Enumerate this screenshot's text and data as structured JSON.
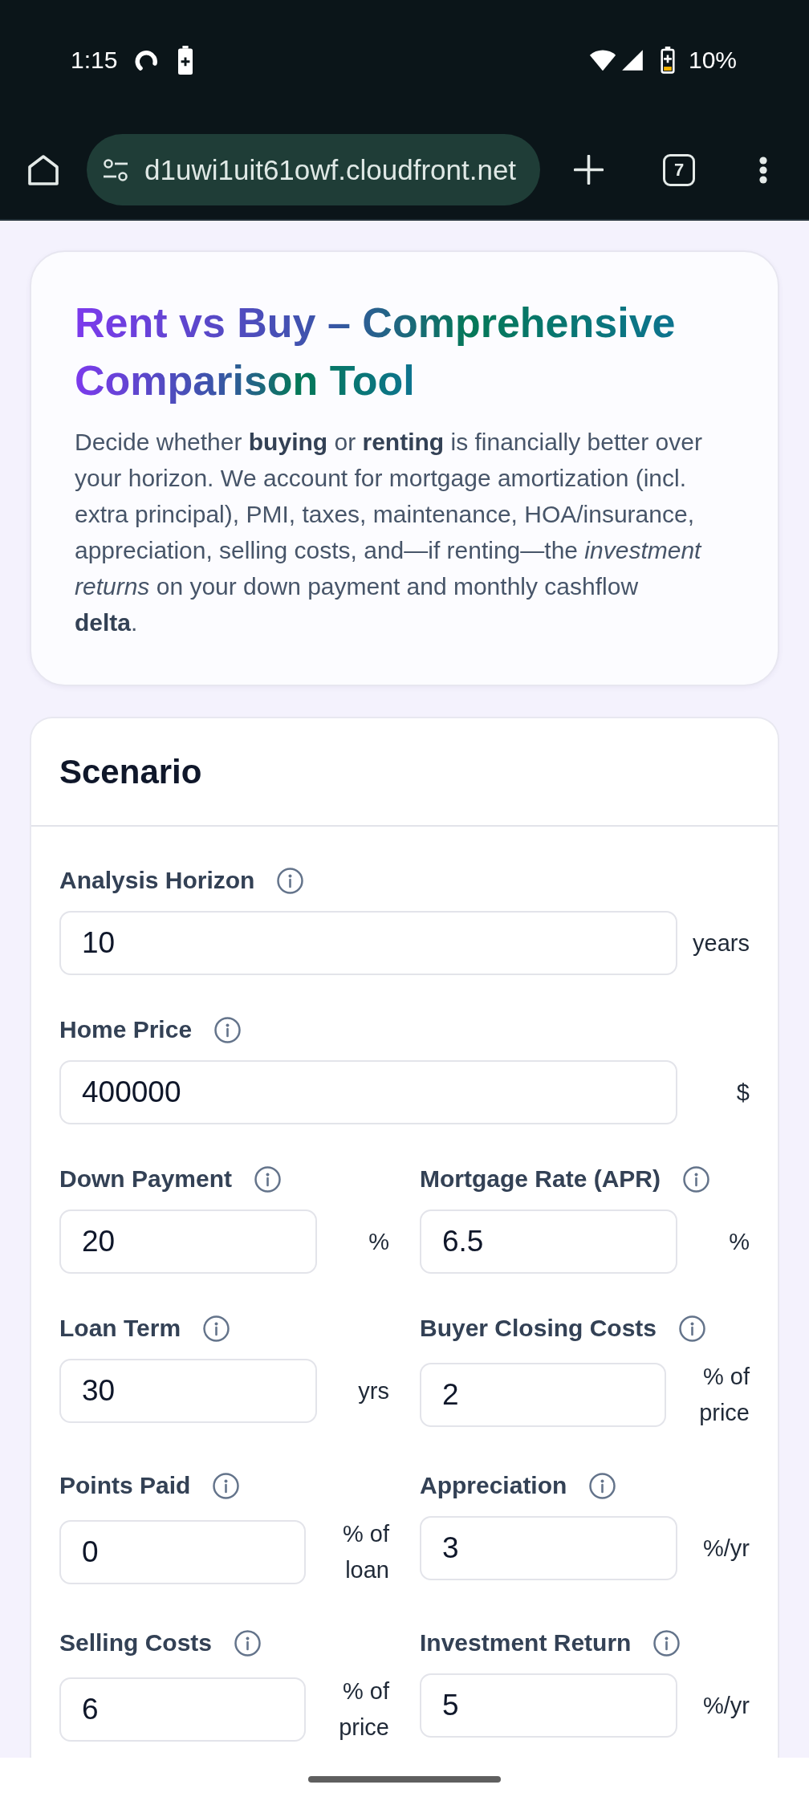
{
  "status_bar": {
    "time": "1:15",
    "battery": "10%"
  },
  "browser": {
    "url": "d1uwi1uit61owf.cloudfront.net",
    "tab_count": "7"
  },
  "header": {
    "title": "Rent vs Buy – Comprehensive Comparison Tool",
    "description": "Decide whether **buying** or **renting** is financially better over your horizon. We account for mortgage amortization (incl. extra principal), PMI, taxes, maintenance, HOA/insurance, appreciation, selling costs, and—if renting—the *investment returns* on your down payment and monthly cashflow **delta**."
  },
  "scenario": {
    "title": "Scenario",
    "rows": [
      {
        "fields": [
          {
            "label": "Analysis Horizon",
            "value": "10",
            "unit": "years"
          }
        ]
      },
      {
        "fields": [
          {
            "label": "Home Price",
            "value": "400000",
            "unit": "$"
          }
        ]
      },
      {
        "fields": [
          {
            "label": "Down Payment",
            "value": "20",
            "unit": "%"
          },
          {
            "label": "Mortgage Rate (APR)",
            "value": "6.5",
            "unit": "%"
          }
        ]
      },
      {
        "fields": [
          {
            "label": "Loan Term",
            "value": "30",
            "unit": "yrs"
          },
          {
            "label": "Buyer Closing Costs",
            "value": "2",
            "unit": "% of price"
          }
        ]
      },
      {
        "fields": [
          {
            "label": "Points Paid",
            "value": "0",
            "unit": "% of loan"
          },
          {
            "label": "Appreciation",
            "value": "3",
            "unit": "%/yr"
          }
        ]
      },
      {
        "fields": [
          {
            "label": "Selling Costs",
            "value": "6",
            "unit": "% of price"
          },
          {
            "label": "Investment Return",
            "value": "5",
            "unit": "%/yr"
          }
        ]
      }
    ]
  }
}
